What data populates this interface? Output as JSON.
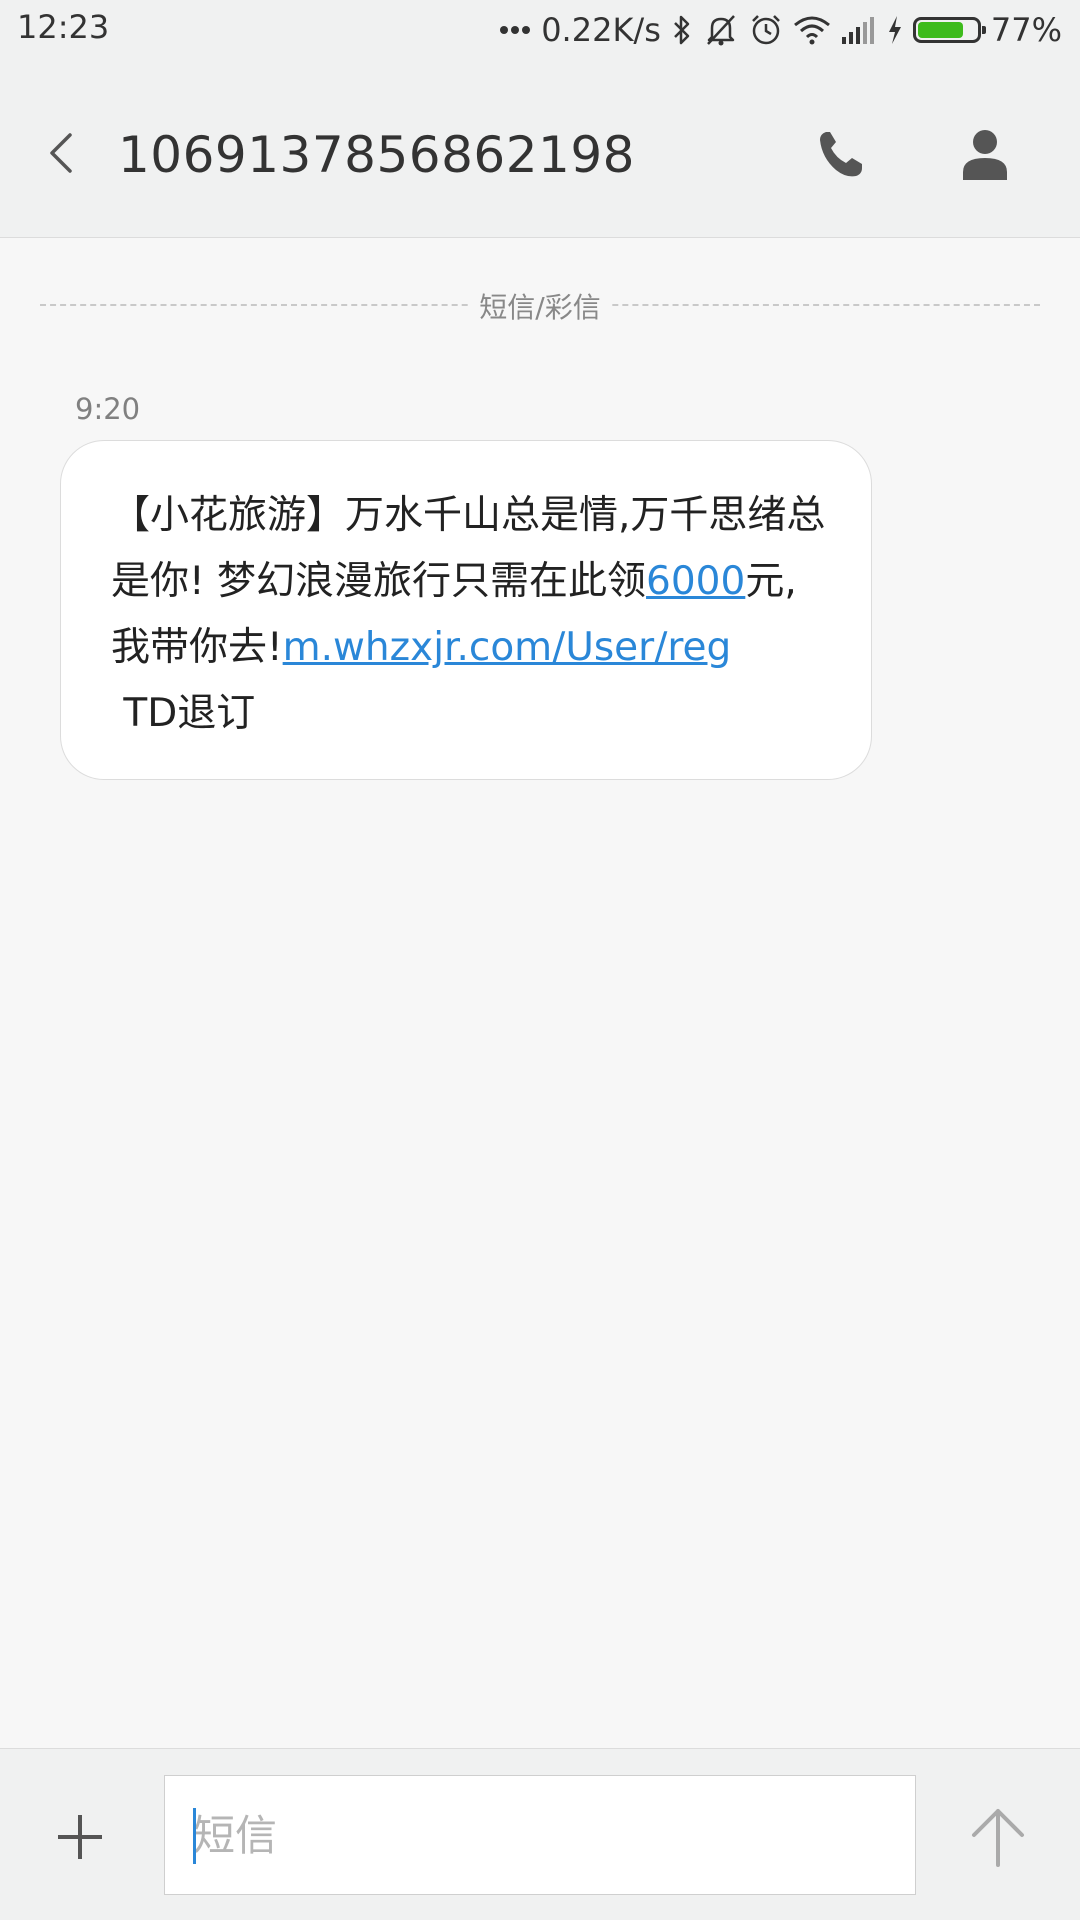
{
  "status_bar": {
    "time": "12:23",
    "network_speed": "0.22K/s",
    "battery_percent": "77%",
    "battery_level": 0.77,
    "icons": [
      "more-dots-icon",
      "bluetooth-icon",
      "silent-icon",
      "alarm-icon",
      "wifi-icon",
      "signal-icon",
      "charging-icon",
      "battery-icon"
    ]
  },
  "header": {
    "title": "1069137856862198",
    "icons": [
      "back-arrow-icon",
      "phone-icon",
      "contact-icon"
    ]
  },
  "divider": {
    "label": "短信/彩信"
  },
  "message": {
    "time": "9:20",
    "text_1": "【小花旅游】万水千山总是情,万千思绪总是你! 梦幻浪漫旅行只需在此领",
    "link_amount": "6000",
    "text_2": "元,我带你去!",
    "link_url": "m.whzxjr.com/User/reg",
    "text_3": " TD退订"
  },
  "composer": {
    "placeholder": "短信",
    "value": "",
    "icons": [
      "plus-icon",
      "send-arrow-icon"
    ]
  },
  "colors": {
    "link": "#2a87d8",
    "battery_fill": "#3dbb1c",
    "background": "#f7f7f7",
    "bar": "#f0f1f1"
  }
}
